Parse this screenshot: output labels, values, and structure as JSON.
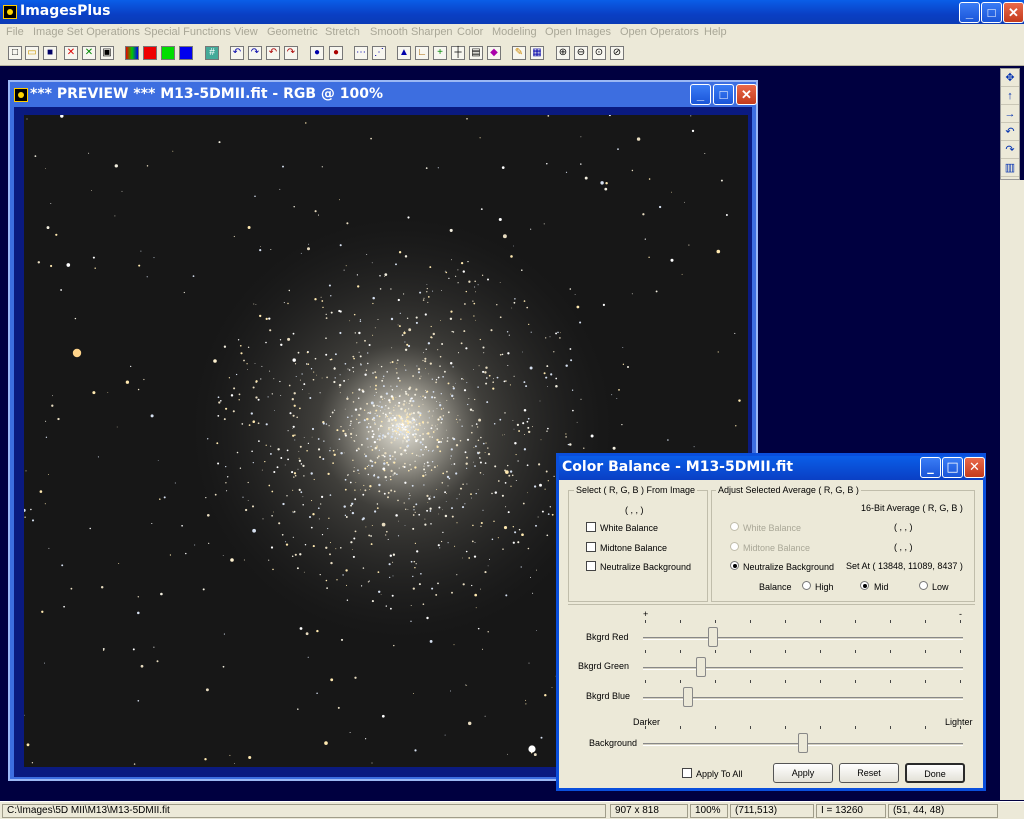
{
  "app": {
    "title": "ImagesPlus"
  },
  "menu": [
    "File",
    "Image Set Operations",
    "Special Functions",
    "View",
    "Geometric",
    "Stretch",
    "Smooth Sharpen",
    "Color",
    "Modeling",
    "Open Images",
    "Open Operators",
    "Help"
  ],
  "preview": {
    "title": "*** PREVIEW *** M13-5DMII.fit - RGB @  100%"
  },
  "dialog": {
    "title": "Color Balance - M13-5DMII.fit",
    "select_group": "Select ( R, G, B ) From Image",
    "select_value": "( , , )",
    "white_balance": "White Balance",
    "midtone_balance": "Midtone Balance",
    "neutralize_background": "Neutralize Background",
    "adjust_group": "Adjust Selected Average ( R, G, B )",
    "avg_header": "16-Bit Average ( R, G, B )",
    "wb_value": "( , , )",
    "mb_value": "( , , )",
    "set_at": "Set At ( 13848, 11089, 8437 )",
    "balance_label": "Balance",
    "high": "High",
    "mid": "Mid",
    "low": "Low",
    "plus": "+",
    "minus": "-",
    "bkgrd_red": "Bkgrd Red",
    "bkgrd_green": "Bkgrd Green",
    "bkgrd_blue": "Bkgrd Blue",
    "darker": "Darker",
    "lighter": "Lighter",
    "background": "Background",
    "apply_to_all": "Apply To All",
    "apply": "Apply",
    "reset": "Reset",
    "done": "Done",
    "slider_red": 0.22,
    "slider_green": 0.18,
    "slider_blue": 0.14,
    "slider_background": 0.5
  },
  "status": {
    "path": "C:\\Images\\5D MII\\M13\\M13-5DMII.fit",
    "dims": "907 x 818",
    "zoom": "100%",
    "coords": "(711,513)",
    "intensity": "I = 13260",
    "rgb": "(51, 44, 48)"
  }
}
